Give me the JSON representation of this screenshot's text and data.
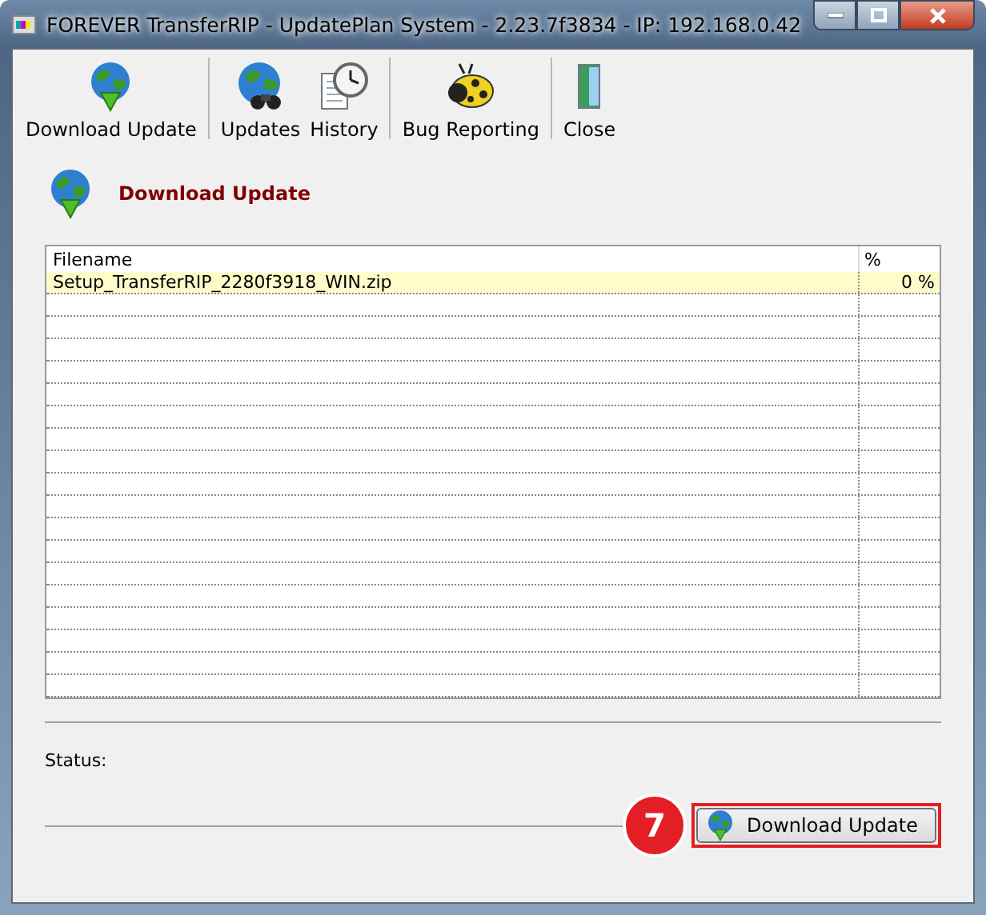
{
  "window": {
    "title": "FOREVER TransferRIP - UpdatePlan System - 2.23.7f3834 - IP: 192.168.0.42"
  },
  "toolbar": [
    [
      {
        "kind": "globe-download",
        "label": "Download Update"
      }
    ],
    [
      {
        "kind": "globe-binoculars",
        "label": "Updates"
      },
      {
        "kind": "clock",
        "label": "History"
      }
    ],
    [
      {
        "kind": "bug",
        "label": "Bug Reporting"
      }
    ],
    [
      {
        "kind": "door",
        "label": "Close"
      }
    ]
  ],
  "section_title": "Download Update",
  "table": {
    "columns": [
      "Filename",
      "%"
    ],
    "rows": [
      {
        "filename": "Setup_TransferRIP_2280f3918_WIN.zip",
        "percent": "0 %",
        "selected": true
      }
    ]
  },
  "status": {
    "label": "Status:"
  },
  "badge": "7",
  "button": {
    "label": "Download Update"
  }
}
